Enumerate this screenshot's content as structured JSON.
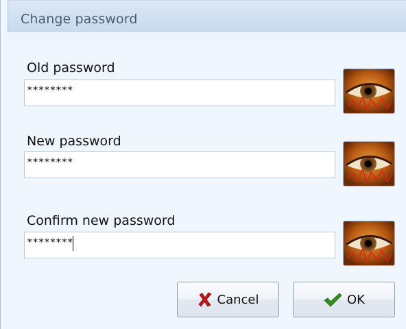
{
  "dialog": {
    "title": "Change password"
  },
  "fields": [
    {
      "label": "Old password",
      "value": "********",
      "focused": false
    },
    {
      "label": "New password",
      "value": "********",
      "focused": false
    },
    {
      "label": "Confirm new password",
      "value": "********",
      "focused": true
    }
  ],
  "reveal_icon": "eye-icon",
  "buttons": {
    "cancel_label": "Cancel",
    "cancel_icon": "x-icon",
    "ok_label": "OK",
    "ok_icon": "checkmark-icon"
  },
  "colors": {
    "cancel_x": "#c0151a",
    "ok_check": "#2f8f1f"
  }
}
